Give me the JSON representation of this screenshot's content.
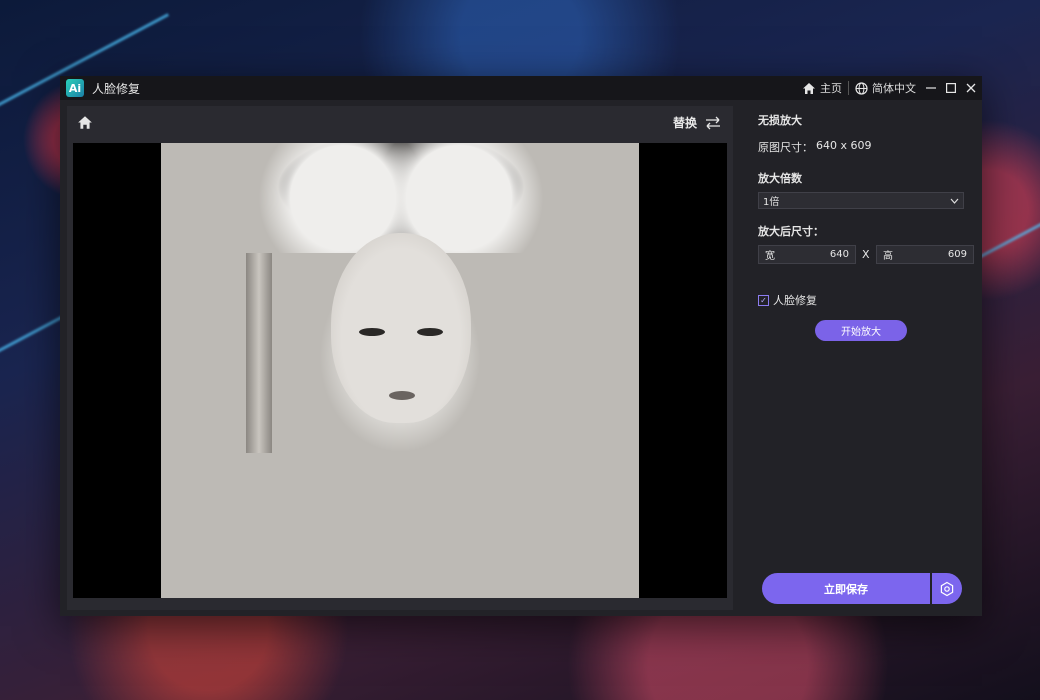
{
  "app": {
    "logo_text": "Ai",
    "title": "人脸修复"
  },
  "titlebar": {
    "home_label": "主页",
    "language_label": "简体中文"
  },
  "left": {
    "replace_label": "替换"
  },
  "panel": {
    "heading": "无损放大",
    "original_size_label": "原图尺寸：",
    "original_size_value": "640 x 609",
    "scale_label": "放大倍数",
    "scale_selected": "1倍",
    "output_size_label": "放大后尺寸：",
    "width_label": "宽",
    "width_value": "640",
    "x_label": "X",
    "height_label": "高",
    "height_value": "609",
    "face_repair_label": "人脸修复",
    "face_repair_checked": true,
    "start_button": "开始放大",
    "save_button": "立即保存"
  },
  "colors": {
    "accent": "#7c66ee",
    "window_bg": "#222227",
    "panel_bg": "#2a2a30"
  }
}
